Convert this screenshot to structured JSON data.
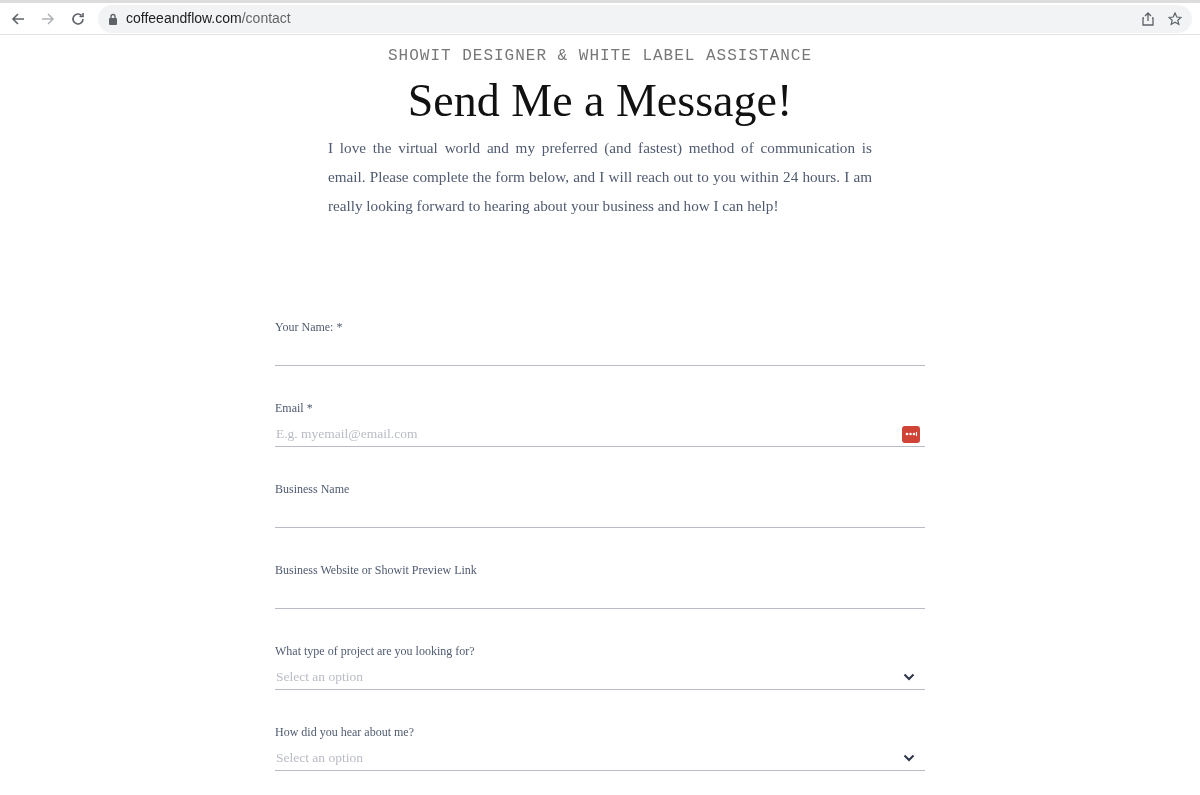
{
  "browser": {
    "url_domain": "coffeeandflow.com",
    "url_path": "/contact"
  },
  "page": {
    "eyebrow": "SHOWIT DESIGNER & WHITE LABEL ASSISTANCE",
    "heading": "Send Me a Message!",
    "intro": "I love the virtual world and my preferred (and fastest) method of communication is email. Please complete the form below, and I will reach out to you within 24 hours. I am really looking forward to hearing about your business and how I can help!"
  },
  "form": {
    "fields": [
      {
        "kind": "text",
        "label": "Your Name: *"
      },
      {
        "kind": "text",
        "label": "Email *",
        "placeholder": "E.g. myemail@email.com",
        "autofill_icon": true
      },
      {
        "kind": "text",
        "label": "Business Name"
      },
      {
        "kind": "text",
        "label": "Business Website or Showit Preview Link"
      },
      {
        "kind": "select",
        "label": "What type of project are you looking for?",
        "placeholder": "Select an option"
      },
      {
        "kind": "select",
        "label": "How did you hear about me?",
        "placeholder": "Select an option"
      }
    ]
  }
}
